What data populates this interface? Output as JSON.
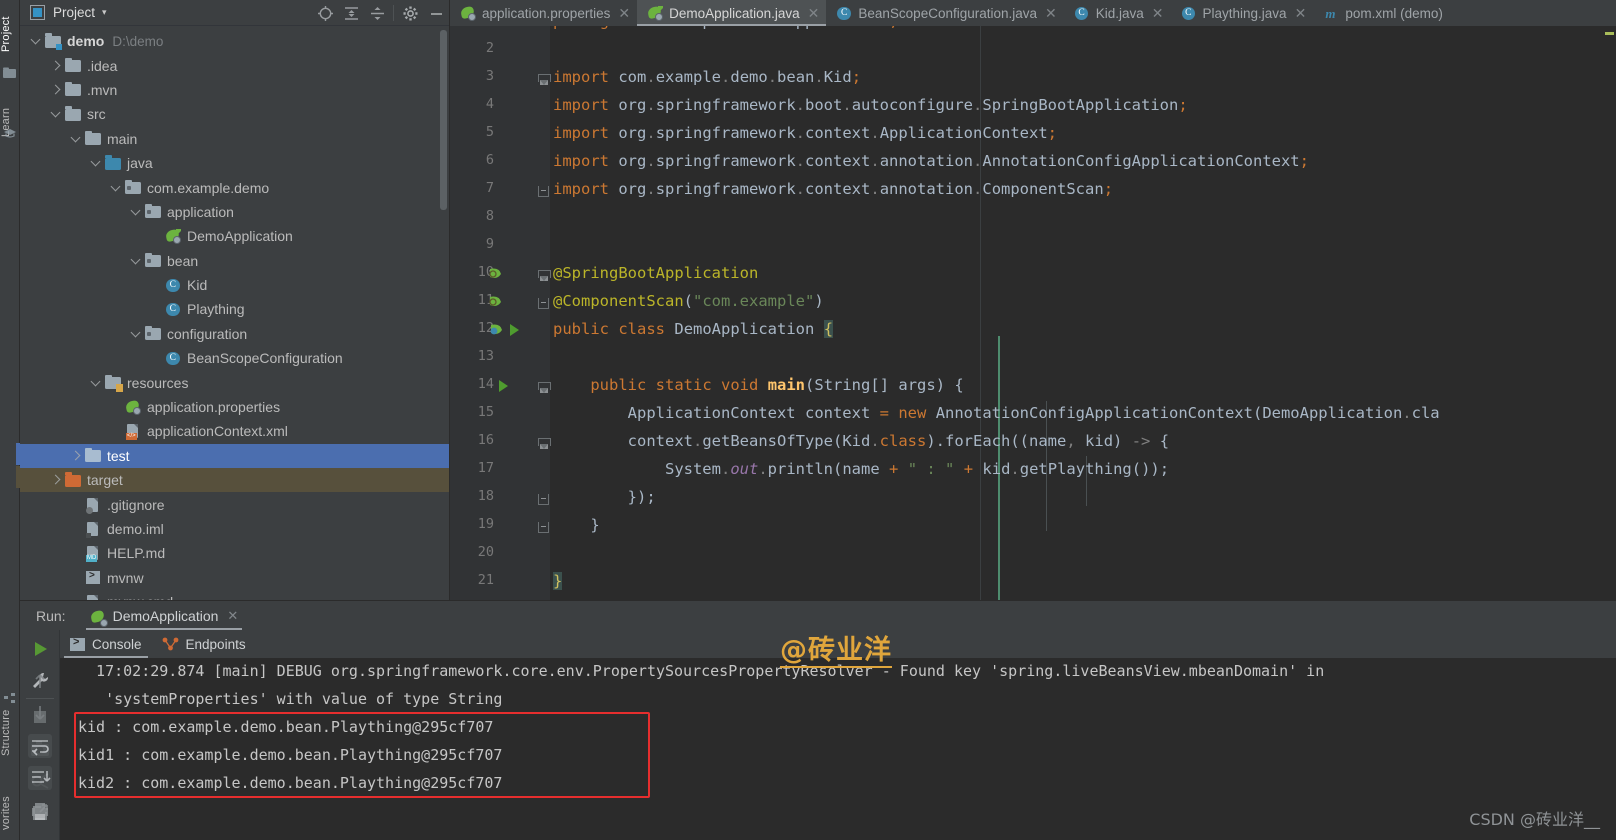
{
  "app": {
    "theme_bg": "#3c3f41",
    "editor_bg": "#2b2b2b",
    "accent": "#4b6eaf",
    "highlight_red": "#e62e2e"
  },
  "left_strip": {
    "items": [
      {
        "label": "Project",
        "icon": "project-icon",
        "selected": true
      },
      {
        "label": "Learn",
        "icon": "graduation-cap-icon",
        "selected": false
      },
      {
        "label": "Structure",
        "icon": "structure-icon",
        "selected": false
      },
      {
        "label": "vorites",
        "icon": "favorites-icon",
        "selected": false
      }
    ]
  },
  "project_panel": {
    "title": "Project",
    "caret": "▾",
    "tools": [
      {
        "name": "locate-target-icon",
        "glyph": "⊕"
      },
      {
        "name": "expand-all-icon",
        "glyph": "⇕"
      },
      {
        "name": "collapse-all-icon",
        "glyph": "⇵"
      },
      {
        "name": "settings-gear-icon",
        "glyph": "⚙"
      },
      {
        "name": "hide-panel-icon",
        "glyph": "—"
      }
    ],
    "tree": [
      {
        "indent": 0,
        "twist": "d",
        "icon": "folder-module",
        "label": "demo",
        "bold": true,
        "path": "D:\\demo",
        "state": "none"
      },
      {
        "indent": 1,
        "twist": "r",
        "icon": "folder-gray",
        "label": ".idea",
        "bold": false,
        "path": "",
        "state": "none"
      },
      {
        "indent": 1,
        "twist": "r",
        "icon": "folder-gray",
        "label": ".mvn",
        "bold": false,
        "path": "",
        "state": "none"
      },
      {
        "indent": 1,
        "twist": "d",
        "icon": "folder-gray",
        "label": "src",
        "bold": false,
        "path": "",
        "state": "none"
      },
      {
        "indent": 2,
        "twist": "d",
        "icon": "folder-gray",
        "label": "main",
        "bold": false,
        "path": "",
        "state": "none"
      },
      {
        "indent": 3,
        "twist": "d",
        "icon": "folder-source",
        "label": "java",
        "bold": false,
        "path": "",
        "state": "none"
      },
      {
        "indent": 4,
        "twist": "d",
        "icon": "folder-package",
        "label": "com.example.demo",
        "bold": false,
        "path": "",
        "state": "none"
      },
      {
        "indent": 5,
        "twist": "d",
        "icon": "folder-package",
        "label": "application",
        "bold": false,
        "path": "",
        "state": "none"
      },
      {
        "indent": 6,
        "twist": "",
        "icon": "spring-class",
        "label": "DemoApplication",
        "bold": false,
        "path": "",
        "state": "none"
      },
      {
        "indent": 5,
        "twist": "d",
        "icon": "folder-package",
        "label": "bean",
        "bold": false,
        "path": "",
        "state": "none"
      },
      {
        "indent": 6,
        "twist": "",
        "icon": "java-class",
        "label": "Kid",
        "bold": false,
        "path": "",
        "state": "none"
      },
      {
        "indent": 6,
        "twist": "",
        "icon": "java-class",
        "label": "Plaything",
        "bold": false,
        "path": "",
        "state": "none"
      },
      {
        "indent": 5,
        "twist": "d",
        "icon": "folder-package",
        "label": "configuration",
        "bold": false,
        "path": "",
        "state": "none"
      },
      {
        "indent": 6,
        "twist": "",
        "icon": "java-class",
        "label": "BeanScopeConfiguration",
        "bold": false,
        "path": "",
        "state": "none"
      },
      {
        "indent": 3,
        "twist": "d",
        "icon": "folder-resource",
        "label": "resources",
        "bold": false,
        "path": "",
        "state": "none"
      },
      {
        "indent": 4,
        "twist": "",
        "icon": "spring-props",
        "label": "application.properties",
        "bold": false,
        "path": "",
        "state": "none"
      },
      {
        "indent": 4,
        "twist": "",
        "icon": "xml-file",
        "label": "applicationContext.xml",
        "bold": false,
        "path": "",
        "state": "none"
      },
      {
        "indent": 2,
        "twist": "r",
        "icon": "folder-test",
        "label": "test",
        "bold": false,
        "path": "",
        "state": "selected"
      },
      {
        "indent": 1,
        "twist": "r",
        "icon": "folder-target",
        "label": "target",
        "bold": false,
        "path": "",
        "state": "excluded"
      },
      {
        "indent": 2,
        "twist": "",
        "icon": "gitignore-file",
        "label": ".gitignore",
        "bold": false,
        "path": "",
        "state": "none"
      },
      {
        "indent": 2,
        "twist": "",
        "icon": "iml-file",
        "label": "demo.iml",
        "bold": false,
        "path": "",
        "state": "none"
      },
      {
        "indent": 2,
        "twist": "",
        "icon": "md-file",
        "label": "HELP.md",
        "bold": false,
        "path": "",
        "state": "none"
      },
      {
        "indent": 2,
        "twist": "",
        "icon": "script-file",
        "label": "mvnw",
        "bold": false,
        "path": "",
        "state": "none"
      },
      {
        "indent": 2,
        "twist": "",
        "icon": "cmd-file",
        "label": "mvnw.cmd",
        "bold": false,
        "path": "",
        "state": "none"
      }
    ]
  },
  "editor_tabs": [
    {
      "label": "application.properties",
      "icon": "spring-properties-icon",
      "active": false,
      "closable": true
    },
    {
      "label": "DemoApplication.java",
      "icon": "spring-boot-class-icon",
      "active": true,
      "closable": true
    },
    {
      "label": "BeanScopeConfiguration.java",
      "icon": "java-class-icon",
      "active": false,
      "closable": true
    },
    {
      "label": "Kid.java",
      "icon": "java-class-icon",
      "active": false,
      "closable": true
    },
    {
      "label": "Plaything.java",
      "icon": "java-class-icon",
      "active": false,
      "closable": true
    },
    {
      "label": "pom.xml (demo)",
      "icon": "maven-icon",
      "active": false,
      "closable": false
    }
  ],
  "editor": {
    "file": "DemoApplication.java",
    "first_visible_line": 1,
    "last_visible_line": 21,
    "lines": [
      {
        "n": 1,
        "text": "package com.example.demo.application;",
        "gutter": "",
        "fold": ""
      },
      {
        "n": 2,
        "text": "",
        "gutter": "",
        "fold": ""
      },
      {
        "n": 3,
        "text": "import com.example.demo.bean.Kid;",
        "gutter": "",
        "fold": "top"
      },
      {
        "n": 4,
        "text": "import org.springframework.boot.autoconfigure.SpringBootApplication;",
        "gutter": "",
        "fold": ""
      },
      {
        "n": 5,
        "text": "import org.springframework.context.ApplicationContext;",
        "gutter": "",
        "fold": ""
      },
      {
        "n": 6,
        "text": "import org.springframework.context.annotation.AnnotationConfigApplicationContext;",
        "gutter": "",
        "fold": ""
      },
      {
        "n": 7,
        "text": "import org.springframework.context.annotation.ComponentScan;",
        "gutter": "",
        "fold": "bottom"
      },
      {
        "n": 8,
        "text": "",
        "gutter": "",
        "fold": ""
      },
      {
        "n": 9,
        "text": "",
        "gutter": "",
        "fold": ""
      },
      {
        "n": 10,
        "text": "@SpringBootApplication",
        "gutter": "spring-bean-gutter-icon",
        "fold": "top"
      },
      {
        "n": 11,
        "text": "@ComponentScan(\"com.example\")",
        "gutter": "spring-bean-gutter-icon",
        "fold": "bottom"
      },
      {
        "n": 12,
        "text": "public class DemoApplication {",
        "gutter": "spring-run-gutter-icon",
        "fold": ""
      },
      {
        "n": 13,
        "text": "",
        "gutter": "",
        "fold": ""
      },
      {
        "n": 14,
        "text": "    public static void main(String[] args) {",
        "gutter": "run-gutter-icon",
        "fold": "top"
      },
      {
        "n": 15,
        "text": "        ApplicationContext context = new AnnotationConfigApplicationContext(DemoApplication.cla",
        "gutter": "",
        "fold": ""
      },
      {
        "n": 16,
        "text": "        context.getBeansOfType(Kid.class).forEach((name, kid) -> {",
        "gutter": "",
        "fold": "top"
      },
      {
        "n": 17,
        "text": "            System.out.println(name + \" : \" + kid.getPlaything());",
        "gutter": "",
        "fold": ""
      },
      {
        "n": 18,
        "text": "        });",
        "gutter": "",
        "fold": "bottom"
      },
      {
        "n": 19,
        "text": "    }",
        "gutter": "",
        "fold": "bottom"
      },
      {
        "n": 20,
        "text": "",
        "gutter": "",
        "fold": ""
      },
      {
        "n": 21,
        "text": "}",
        "gutter": "",
        "fold": ""
      }
    ]
  },
  "run_panel": {
    "label": "Run:",
    "config_name": "DemoApplication",
    "config_icon": "spring-boot-icon",
    "close_glyph": "✕",
    "tools": [
      {
        "name": "rerun-button",
        "glyph": "▶"
      },
      {
        "name": "edit-configuration-button",
        "glyph": "wrench"
      },
      {
        "name": "stop-button",
        "glyph": "■"
      },
      {
        "name": "screenshot-button",
        "glyph": "camera"
      },
      {
        "name": "thread-dump-button",
        "glyph": "dump"
      },
      {
        "name": "attach-button",
        "glyph": "attach"
      }
    ],
    "sub_tabs": [
      {
        "label": "Console",
        "icon": "console-icon",
        "active": true
      },
      {
        "label": "Endpoints",
        "icon": "endpoints-icon",
        "active": false
      }
    ],
    "console_tools": [
      {
        "name": "scroll-up-icon",
        "glyph": "↑"
      },
      {
        "name": "scroll-down-icon",
        "glyph": "↓"
      },
      {
        "name": "soft-wrap-icon",
        "glyph": "wrap"
      },
      {
        "name": "scroll-to-end-icon",
        "glyph": "end"
      },
      {
        "name": "print-icon",
        "glyph": "print"
      }
    ],
    "console_lines": [
      {
        "text": "  17:02:29.874 [main] DEBUG org.springframework.core.env.PropertySourcesPropertyResolver - Found key 'spring.liveBeansView.mbeanDomain' in",
        "boxed": false
      },
      {
        "text": "   'systemProperties' with value of type String",
        "boxed": false
      },
      {
        "text": "kid : com.example.demo.bean.Plaything@295cf707",
        "boxed": true
      },
      {
        "text": "kid1 : com.example.demo.bean.Plaything@295cf707",
        "boxed": true
      },
      {
        "text": "kid2 : com.example.demo.bean.Plaything@295cf707",
        "boxed": true
      }
    ]
  },
  "watermarks": {
    "top": "@砖业洋",
    "bottom": "CSDN @砖业洋__"
  }
}
